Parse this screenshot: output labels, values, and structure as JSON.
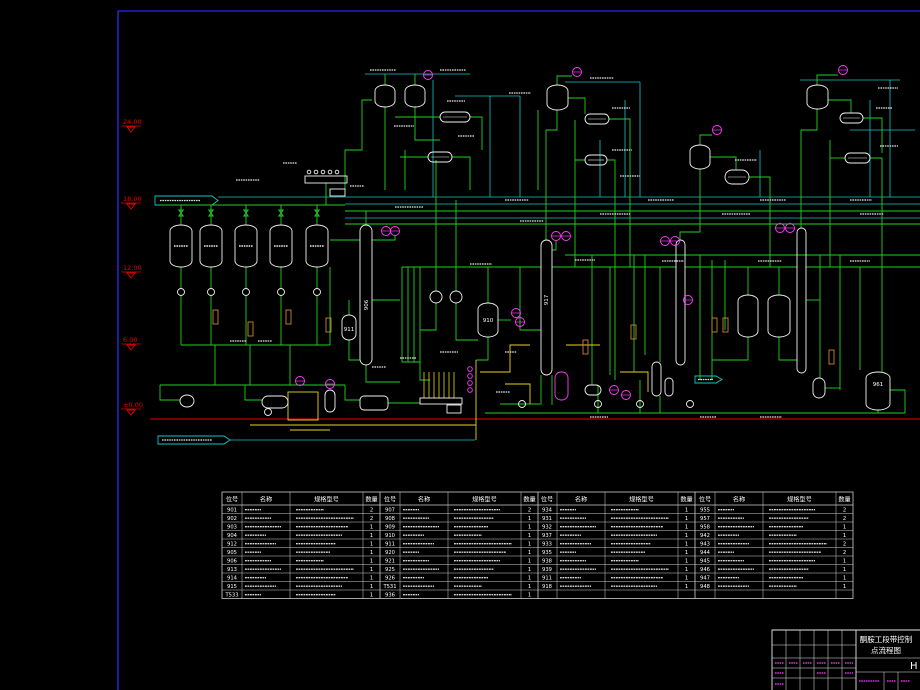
{
  "drawing": {
    "title_lines": [
      "酮胺工段带控制",
      "点流程图"
    ],
    "sheet_mark": "H",
    "elevations": [
      "24.00",
      "18.00",
      "12.00",
      "6.00",
      "±0.00"
    ],
    "equipment_tags": [
      "906",
      "910",
      "911",
      "917",
      "961"
    ]
  },
  "equipment_table": {
    "headers": [
      "位号",
      "名称",
      "规格型号",
      "数量"
    ],
    "groups": [
      {
        "tags": [
          "901",
          "902",
          "903",
          "904",
          "912",
          "905",
          "906",
          "913",
          "914",
          "915",
          "T533"
        ],
        "qty": [
          "2",
          "2",
          "1",
          "1",
          "1",
          "1",
          "1",
          "1",
          "1",
          "1",
          "1"
        ]
      },
      {
        "tags": [
          "907",
          "908",
          "909",
          "910",
          "911",
          "920",
          "921",
          "925",
          "926",
          "T531",
          "936"
        ],
        "qty": [
          "2",
          "1",
          "1",
          "1",
          "1",
          "1",
          "1",
          "1",
          "1",
          "1",
          "1"
        ]
      },
      {
        "tags": [
          "934",
          "931",
          "932",
          "937",
          "933",
          "935",
          "938",
          "939",
          "911",
          "918"
        ],
        "qty": [
          "1",
          "1",
          "1",
          "1",
          "1",
          "1",
          "1",
          "1",
          "1",
          "1"
        ]
      },
      {
        "tags": [
          "955",
          "957",
          "958",
          "942",
          "943",
          "944",
          "945",
          "946",
          "947",
          "948"
        ],
        "qty": [
          "2",
          "2",
          "1",
          "1",
          "2",
          "2",
          "1",
          "1",
          "1",
          "1"
        ]
      }
    ]
  },
  "colors": {
    "background": "#000000",
    "frame": "#2b2bf0",
    "process_line": "#1fd21f",
    "utility_line": "#12c6c6",
    "steam_line": "#e8d41a",
    "equipment": "#f2f2f2",
    "instrument": "#ff3cff",
    "elevation": "#e80000",
    "strainer": "#d2842a",
    "table_line": "#cfcfcf"
  }
}
